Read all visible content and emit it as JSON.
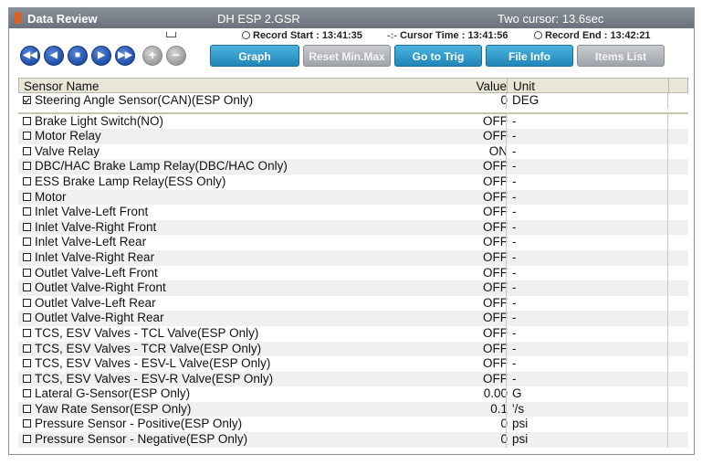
{
  "titlebar": {
    "title": "Data Review",
    "file": "DH ESP 2.GSR",
    "cursor": "Two cursor: 13.6sec"
  },
  "toolbar": {
    "record_start_label": "Record Start :",
    "record_start": "13:41:35",
    "cursor_time_label": "Cursor Time :",
    "cursor_time": "13:41:56",
    "record_end_label": "Record End :",
    "record_end": "13:42:21",
    "buttons": {
      "graph": "Graph",
      "reset": "Reset Min.Max",
      "goto": "Go to Trig",
      "fileinfo": "File Info",
      "items": "Items List"
    },
    "nav_icons": [
      "rewind-icon",
      "prev-icon",
      "stop-icon",
      "play-icon",
      "fast-forward-icon",
      "add-icon",
      "remove-icon"
    ]
  },
  "table": {
    "headers": {
      "name": "Sensor Name",
      "value": "Value",
      "unit": "Unit"
    },
    "pinned": [
      {
        "name": "Steering Angle Sensor(CAN)(ESP Only)",
        "value": "0",
        "unit": "DEG",
        "checked": true
      }
    ],
    "rows": [
      {
        "name": "Brake Light Switch(NO)",
        "value": "OFF",
        "unit": "-"
      },
      {
        "name": "Motor Relay",
        "value": "OFF",
        "unit": "-"
      },
      {
        "name": "Valve Relay",
        "value": "ON",
        "unit": "-"
      },
      {
        "name": "DBC/HAC Brake Lamp Relay(DBC/HAC Only)",
        "value": "OFF",
        "unit": "-"
      },
      {
        "name": "ESS Brake Lamp Relay(ESS Only)",
        "value": "OFF",
        "unit": "-"
      },
      {
        "name": "Motor",
        "value": "OFF",
        "unit": "-"
      },
      {
        "name": "Inlet Valve-Left Front",
        "value": "OFF",
        "unit": "-"
      },
      {
        "name": "Inlet Valve-Right Front",
        "value": "OFF",
        "unit": "-"
      },
      {
        "name": "Inlet Valve-Left Rear",
        "value": "OFF",
        "unit": "-"
      },
      {
        "name": "Inlet Valve-Right Rear",
        "value": "OFF",
        "unit": "-"
      },
      {
        "name": "Outlet Valve-Left Front",
        "value": "OFF",
        "unit": "-"
      },
      {
        "name": "Outlet Valve-Right Front",
        "value": "OFF",
        "unit": "-"
      },
      {
        "name": "Outlet Valve-Left Rear",
        "value": "OFF",
        "unit": "-"
      },
      {
        "name": "Outlet Valve-Right Rear",
        "value": "OFF",
        "unit": "-"
      },
      {
        "name": "TCS, ESV Valves - TCL Valve(ESP Only)",
        "value": "OFF",
        "unit": "-"
      },
      {
        "name": "TCS, ESV Valves - TCR Valve(ESP Only)",
        "value": "OFF",
        "unit": "-"
      },
      {
        "name": "TCS, ESV Valves - ESV-L Valve(ESP Only)",
        "value": "OFF",
        "unit": "-"
      },
      {
        "name": "TCS, ESV Valves - ESV-R Valve(ESP Only)",
        "value": "OFF",
        "unit": "-"
      },
      {
        "name": "Lateral G-Sensor(ESP Only)",
        "value": "0.00",
        "unit": "G"
      },
      {
        "name": "Yaw Rate Sensor(ESP Only)",
        "value": "0.1",
        "unit": "'/s"
      },
      {
        "name": "Pressure Sensor - Positive(ESP Only)",
        "value": "0",
        "unit": "psi"
      },
      {
        "name": "Pressure Sensor - Negative(ESP Only)",
        "value": "0",
        "unit": "psi"
      }
    ]
  },
  "colors": {
    "accent_blue": "#1f86b8",
    "header_bg": "#e9e6d8",
    "titlebar": "#6b717a"
  }
}
